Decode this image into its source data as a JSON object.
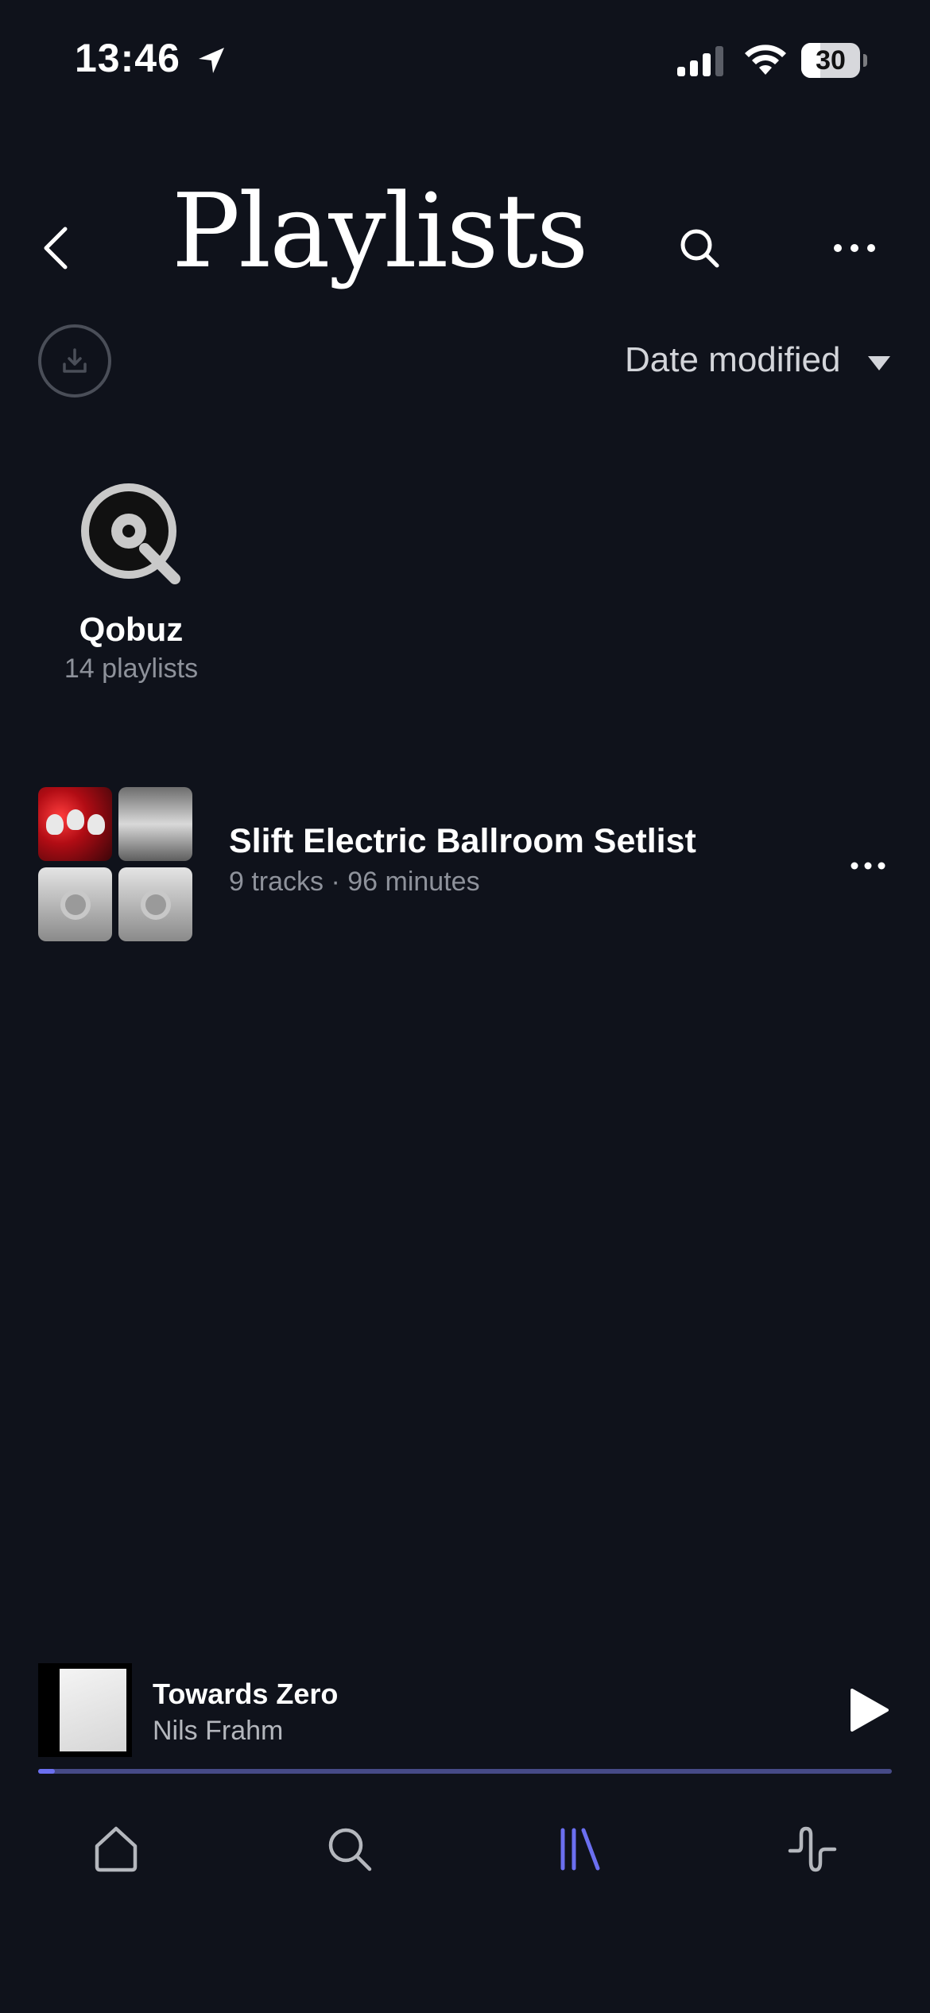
{
  "status_bar": {
    "time": "13:46",
    "battery": "30"
  },
  "header": {
    "title": "Playlists"
  },
  "sort": {
    "label": "Date modified"
  },
  "qobuz": {
    "name": "Qobuz",
    "count": "14 playlists"
  },
  "playlists": [
    {
      "title": "Slift Electric Ballroom Setlist",
      "meta": "9 tracks · 96 minutes"
    }
  ],
  "now_playing": {
    "title": "Towards Zero",
    "artist": "Nils Frahm",
    "progress": 0.02
  },
  "tabs": [
    "home",
    "search",
    "library",
    "activity"
  ],
  "colors": {
    "background": "#0f121b",
    "accent": "#6b6ff0",
    "muted_text": "#8e929b"
  }
}
